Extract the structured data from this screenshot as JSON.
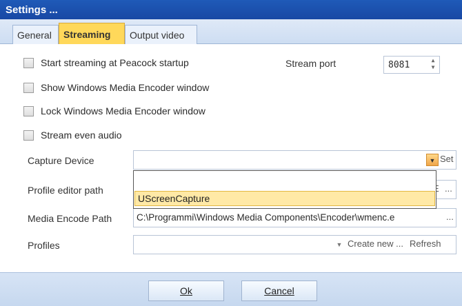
{
  "window": {
    "title": "Settings ..."
  },
  "tabs": [
    {
      "label": "General"
    },
    {
      "label": "Streaming"
    },
    {
      "label": "Output video"
    }
  ],
  "options": [
    {
      "label": "Start streaming at Peacock startup",
      "checked": false
    },
    {
      "label": "Show Windows Media Encoder window",
      "checked": false
    },
    {
      "label": "Lock Windows Media Encoder window",
      "checked": false
    },
    {
      "label": "Stream even audio",
      "checked": false
    }
  ],
  "stream_port": {
    "label": "Stream port",
    "value": "8081"
  },
  "capture_device": {
    "label": "Capture Device",
    "value": "",
    "set_button": "Set"
  },
  "dropdown_popup": {
    "items": [
      "",
      "UScreenCapture"
    ]
  },
  "profile_editor_path": {
    "label": "Profile editor path",
    "value_tail": "E",
    "browse_button": "..."
  },
  "media_encode_path": {
    "label": "Media Encode Path",
    "value": "C:\\Programmi\\Windows Media Components\\Encoder\\wmenc.e",
    "browse_button": "..."
  },
  "profiles": {
    "label": "Profiles",
    "value": "",
    "create_button": "Create new ...",
    "refresh_button": "Refresh"
  },
  "footer": {
    "ok": "Ok",
    "cancel": "Cancel"
  },
  "colors": {
    "titlebar": "#1f5ab8",
    "active_tab": "#ffd85a",
    "highlight": "#ffe9a6",
    "footer": "#c6d8ef"
  }
}
